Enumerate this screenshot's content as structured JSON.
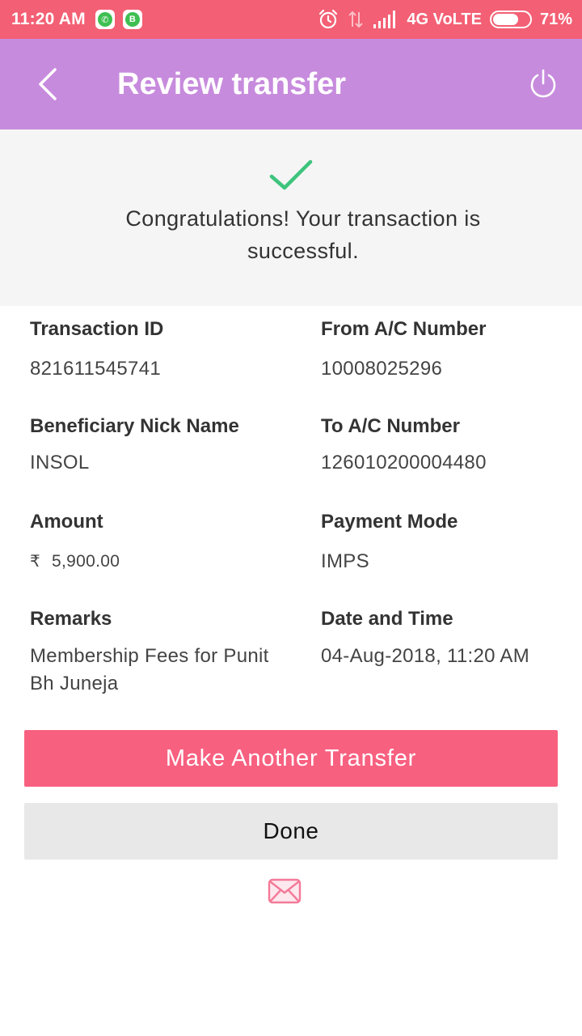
{
  "status_bar": {
    "time": "11:20 AM",
    "network": "4G VoLTE",
    "battery": "71%",
    "battery_level": 0.71,
    "icons": [
      "whatsapp-icon",
      "whatsapp-business-icon",
      "alarm-icon",
      "data-arrows-icon",
      "signal-icon",
      "battery-icon"
    ]
  },
  "header": {
    "title": "Review transfer",
    "back_icon": "chevron-left-icon",
    "power_icon": "power-icon"
  },
  "success": {
    "icon": "check-icon",
    "message": "Congratulations! Your transaction is successful."
  },
  "details": {
    "transaction_id_label": "Transaction ID",
    "transaction_id": "821611545741",
    "from_ac_label": "From A/C Number",
    "from_ac": "10008025296",
    "beneficiary_label": "Beneficiary Nick Name",
    "beneficiary": "INSOL",
    "to_ac_label": "To A/C Number",
    "to_ac": "126010200004480",
    "amount_label": "Amount",
    "currency_symbol": "₹",
    "amount": "5,900.00",
    "payment_mode_label": "Payment Mode",
    "payment_mode": "IMPS",
    "remarks_label": "Remarks",
    "remarks": "Membership Fees for Punit Bh Juneja",
    "datetime_label": "Date and Time",
    "datetime": "04-Aug-2018, 11:20 AM"
  },
  "actions": {
    "make_another": "Make Another Transfer",
    "done": "Done",
    "mail_icon": "mail-icon"
  },
  "colors": {
    "status_bar": "#f35f74",
    "header": "#c78bdd",
    "primary_button": "#f86080",
    "secondary_button": "#e8e8e8",
    "success_check": "#3cc47c"
  }
}
